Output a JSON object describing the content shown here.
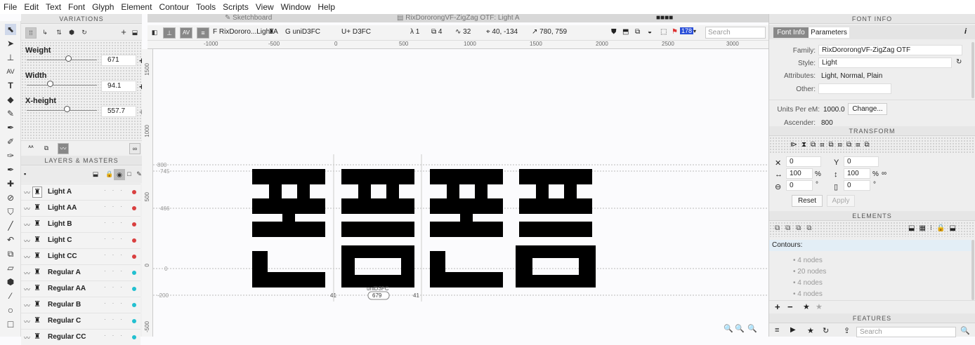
{
  "menu": [
    "File",
    "Edit",
    "Text",
    "Font",
    "Glyph",
    "Element",
    "Contour",
    "Tools",
    "Scripts",
    "View",
    "Window",
    "Help"
  ],
  "tabs": {
    "sketchboard": "Sketchboard",
    "document": "RixDororongVF-ZigZag OTF: Light A",
    "glyph_strip": "■■■■"
  },
  "variations": {
    "title": "VARIATIONS",
    "axes": [
      {
        "name": "Weight",
        "value": "671",
        "knob_position": 0.6
      },
      {
        "name": "Width",
        "value": "94.1",
        "knob_position": 0.32
      },
      {
        "name": "X-height",
        "value": "557.7",
        "knob_position": 0.58
      }
    ]
  },
  "layers": {
    "title": "LAYERS & MASTERS",
    "items": [
      {
        "name": "Light A",
        "color": "#d94040"
      },
      {
        "name": "Light AA",
        "color": "#d94040"
      },
      {
        "name": "Light B",
        "color": "#d94040"
      },
      {
        "name": "Light C",
        "color": "#d94040"
      },
      {
        "name": "Light CC",
        "color": "#d94040"
      },
      {
        "name": "Regular A",
        "color": "#22c0d0"
      },
      {
        "name": "Regular AA",
        "color": "#22c0d0"
      },
      {
        "name": "Regular B",
        "color": "#22c0d0"
      },
      {
        "name": "Regular C",
        "color": "#22c0d0"
      },
      {
        "name": "Regular CC",
        "color": "#22c0d0"
      }
    ]
  },
  "toolbar": {
    "font_name": "RixDororo...Light A",
    "glyph_name": "uniD3FC",
    "unicode": "D3FC",
    "stat_a": "1",
    "stat_b": "4",
    "stat_c": "32",
    "coords": "40, -134",
    "size": "780, 759",
    "zoom": "178",
    "search_placeholder": "Search"
  },
  "ruler": {
    "h": [
      "-1000",
      "-500",
      "0",
      "500",
      "1000",
      "1500",
      "2000",
      "2500",
      "3000"
    ],
    "v": [
      "1500",
      "1000",
      "500",
      "0",
      "-500"
    ]
  },
  "canvas": {
    "guides": [
      "800",
      "745",
      "466",
      "0",
      "-200"
    ],
    "glyph_label": "uniD3FC",
    "lsb": "41",
    "width": "679",
    "rsb": "41"
  },
  "font_info": {
    "title": "FONT INFO",
    "tab_info": "Font Info",
    "tab_params": "Parameters",
    "family_label": "Family:",
    "family": "RixDororongVF-ZigZag OTF",
    "style_label": "Style:",
    "style": "Light",
    "attributes_label": "Attributes:",
    "attributes": "Light, Normal, Plain",
    "other_label": "Other:",
    "upm_label": "Units Per eM:",
    "upm": "1000.0",
    "change_button": "Change...",
    "ascender_label": "Ascender:",
    "ascender": "800"
  },
  "transform": {
    "title": "TRANSFORM",
    "x": "0",
    "y": "0",
    "w": "100",
    "h": "100",
    "rot": "0",
    "slant": "0",
    "pct": "%",
    "deg": "°",
    "reset": "Reset",
    "apply": "Apply"
  },
  "elements": {
    "title": "ELEMENTS",
    "contours_label": "Contours:",
    "nodes": [
      "4 nodes",
      "20 nodes",
      "4 nodes",
      "4 nodes"
    ]
  },
  "features": {
    "title": "FEATURES",
    "search_placeholder": "Search"
  }
}
